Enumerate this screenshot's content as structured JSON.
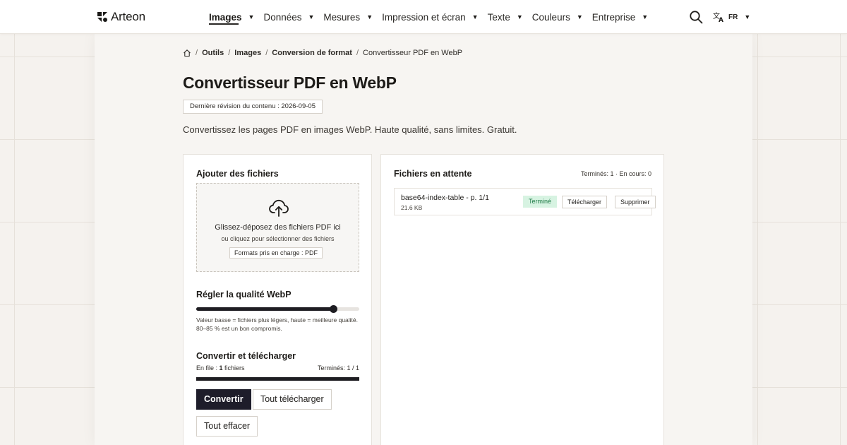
{
  "header": {
    "brand": "Arteon",
    "nav": [
      {
        "label": "Images",
        "active": true
      },
      {
        "label": "Données",
        "active": false
      },
      {
        "label": "Mesures",
        "active": false
      },
      {
        "label": "Impression et écran",
        "active": false
      },
      {
        "label": "Texte",
        "active": false
      },
      {
        "label": "Couleurs",
        "active": false
      },
      {
        "label": "Entreprise",
        "active": false
      }
    ],
    "language": "FR"
  },
  "breadcrumb": {
    "items": [
      "Outils",
      "Images",
      "Conversion de format"
    ],
    "current": "Convertisseur PDF en WebP"
  },
  "page": {
    "title": "Convertisseur PDF en WebP",
    "revision": "Dernière révision du contenu : 2026-09-05",
    "lead": "Convertissez les pages PDF en images WebP. Haute qualité, sans limites. Gratuit."
  },
  "upload": {
    "title": "Ajouter des fichiers",
    "drop_title": "Glissez-déposez des fichiers PDF ici",
    "drop_sub": "ou cliquez pour sélectionner des fichiers",
    "formats": "Formats pris en charge : PDF"
  },
  "quality": {
    "title": "Régler la qualité WebP",
    "value_fraction": 0.84,
    "help": "Valeur basse = fichiers plus légers, haute = meilleure qualité. 80–85 % est un bon compromis."
  },
  "convert": {
    "title": "Convertir et télécharger",
    "queue_prefix": "En file : ",
    "queue_count": "1",
    "queue_suffix": " fichiers",
    "done": "Terminés: 1 / 1",
    "progress_fraction": 1.0,
    "convert_label": "Convertir",
    "download_all_label": "Tout télécharger",
    "clear_label": "Tout effacer"
  },
  "files": {
    "title": "Fichiers en attente",
    "counters": "Terminés: 1 · En cours: 0",
    "items": [
      {
        "name": "base64-index-table - p. 1/1",
        "size": "21.6 KB",
        "status": "Terminé",
        "download_label": "Télécharger",
        "delete_label": "Supprimer"
      }
    ]
  },
  "colors": {
    "accent": "#1e1d2a",
    "status_done_bg": "#d7f3e2",
    "status_done_text": "#1c7a44"
  }
}
